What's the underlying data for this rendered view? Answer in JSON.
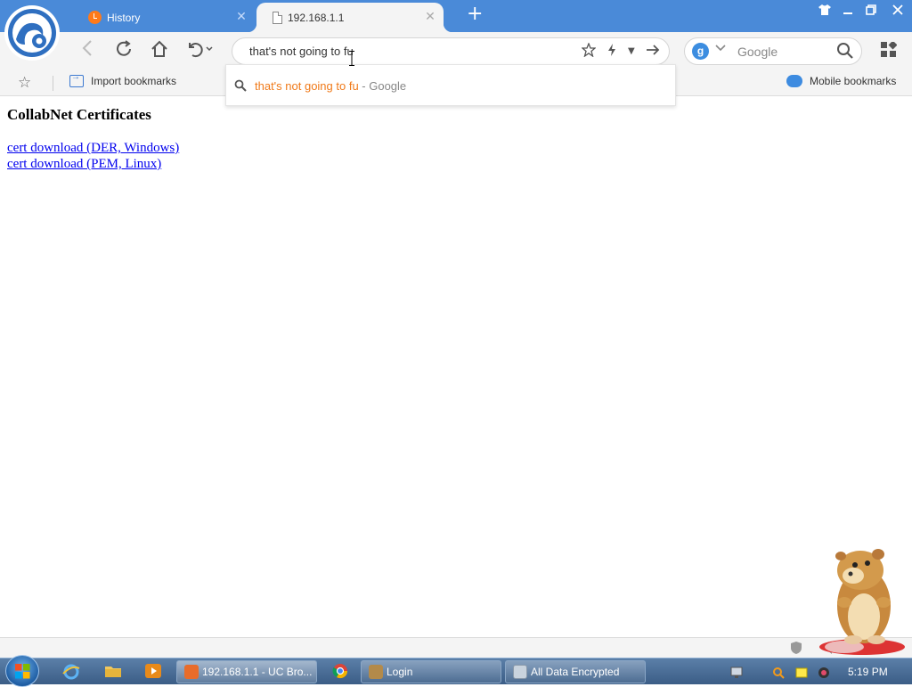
{
  "browser": {
    "tabs": [
      {
        "label": "History",
        "active": false
      },
      {
        "label": "192.168.1.1",
        "active": true
      }
    ],
    "address_value": "that's not going to fu",
    "search": {
      "engine_badge": "g",
      "placeholder": "Google"
    },
    "suggestion": {
      "query": "that's not going to fu",
      "engine_suffix": " - Google"
    },
    "bookmarks": {
      "import_label": "Import bookmarks",
      "mobile_label": "Mobile bookmarks"
    }
  },
  "page": {
    "title": "CollabNet Certificates",
    "links": [
      {
        "label": "cert download (DER, Windows)"
      },
      {
        "label": "cert download (PEM, Linux)"
      }
    ]
  },
  "taskbar": {
    "windows": [
      {
        "label": "192.168.1.1 - UC Bro...",
        "active": true
      },
      {
        "label": "Login",
        "active": false
      },
      {
        "label": "All Data Encrypted",
        "active": false
      }
    ],
    "clock": "5:19 PM"
  },
  "colors": {
    "titlebar": "#4a8ad8",
    "link": "#0000ee",
    "suggest_query": "#f07a1a"
  }
}
